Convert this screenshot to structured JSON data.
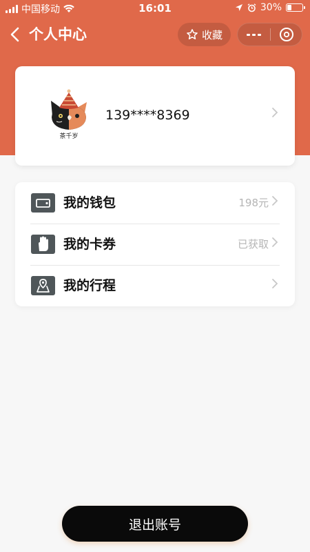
{
  "status_bar": {
    "carrier": "中国移动",
    "time": "16:01",
    "battery_percent": 30,
    "battery_label": "30%"
  },
  "nav": {
    "title": "个人中心",
    "favorite_label": "收藏"
  },
  "profile": {
    "phone": "139****8369",
    "avatar_brand": "茶千岁"
  },
  "menu": {
    "items": [
      {
        "label": "我的钱包",
        "value": "198元",
        "icon": "wallet-icon"
      },
      {
        "label": "我的卡券",
        "value": "已获取",
        "icon": "hand-card-icon"
      },
      {
        "label": "我的行程",
        "value": "",
        "icon": "map-location-icon"
      }
    ]
  },
  "logout": {
    "label": "退出账号"
  },
  "colors": {
    "header": "#e0694a",
    "page_bg": "#f7f7f7",
    "icon_box": "#4f5659",
    "logout_bg": "#0a0a0a"
  }
}
